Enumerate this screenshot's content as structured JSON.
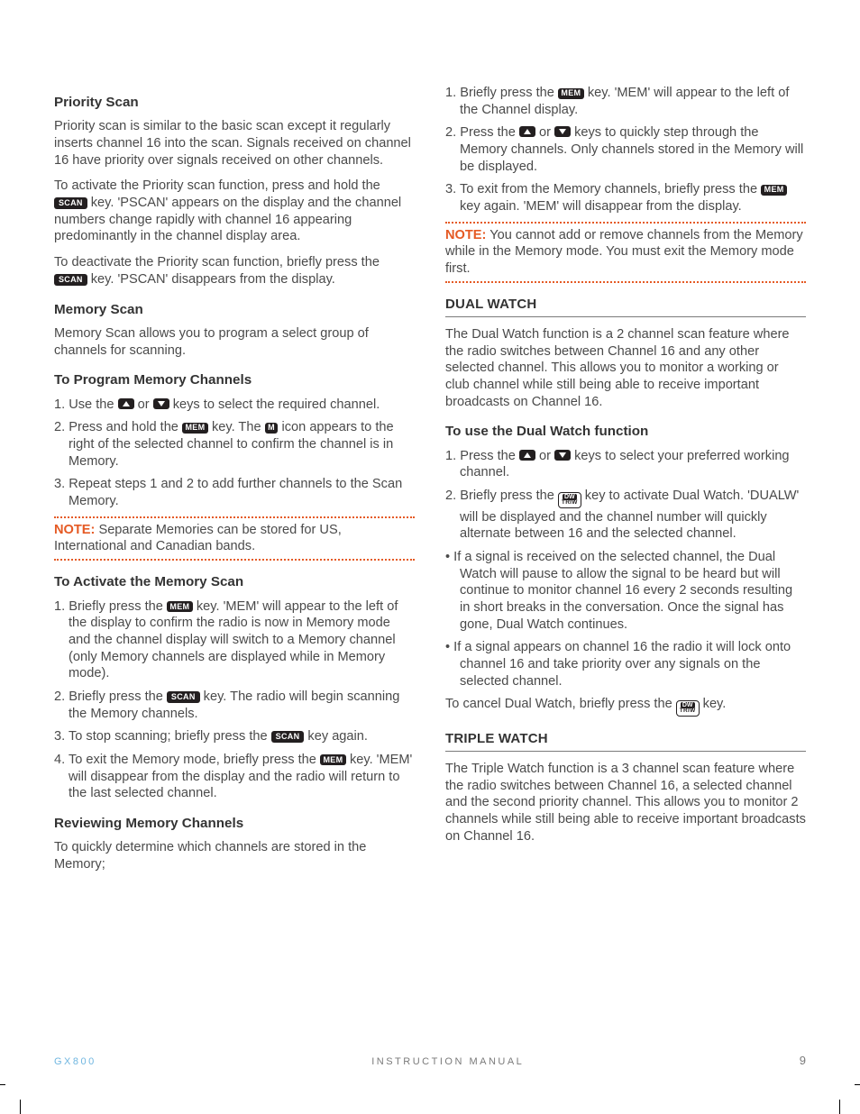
{
  "left": {
    "h1": "Priority Scan",
    "p1": "Priority scan is similar to the basic scan except it regularly inserts channel 16 into the scan. Signals received on channel 16 have priority over signals received on other channels.",
    "p2a": "To activate the Priority scan function, press and hold the ",
    "p2b": " key. 'PSCAN' appears on the display and the channel numbers change rapidly with channel 16 appearing predominantly in the channel display area.",
    "p3a": "To deactivate the Priority scan function, briefly press the ",
    "p3b": " key. 'PSCAN' disappears from the display.",
    "h2": "Memory Scan",
    "p4": "Memory Scan allows you to program a select group of channels for scanning.",
    "h3": "To Program Memory Channels",
    "s1a": "1. Use the ",
    "s1b": " or ",
    "s1c": " keys to select the required channel.",
    "s2a": "2. Press and hold the ",
    "s2b": " key. The ",
    "s2c": " icon appears to the right of the selected channel to confirm the channel is in Memory.",
    "s3": "3. Repeat steps 1 and 2 to add further channels to the Scan Memory.",
    "noteLabel": "NOTE:",
    "noteText": " Separate Memories can be stored for US, International and Canadian bands.",
    "h4": "To Activate the Memory Scan",
    "a1a": "1. Briefly press the ",
    "a1b": " key. 'MEM' will appear to the left of the display to confirm the radio is now in Memory mode and the channel display will switch to a Memory channel (only Memory channels are displayed while in Memory mode).",
    "a2a": "2. Briefly press the ",
    "a2b": " key. The radio will begin scanning the Memory channels.",
    "a3a": "3. To stop scanning; briefly press the ",
    "a3b": " key again.",
    "a4a": "4. To exit the Memory mode, briefly press the ",
    "a4b": " key. 'MEM' will disappear from the display and the radio will return to the last selected channel.",
    "h5": "Reviewing Memory Channels",
    "p5": "To quickly determine which channels are stored in the Memory;"
  },
  "right": {
    "r1a": "1. Briefly press the ",
    "r1b": " key. 'MEM' will appear to the left of the Channel display.",
    "r2a": "2. Press the ",
    "r2b": " or ",
    "r2c": " keys to quickly step through the Memory channels. Only channels stored in the Memory will be displayed.",
    "r3a": "3. To exit from the Memory channels, briefly press the ",
    "r3b": " key again. 'MEM' will disappear from the display.",
    "noteLabel": "NOTE:",
    "noteText": " You cannot add or remove channels from the Memory while in the Memory mode. You must exit the Memory mode first.",
    "h1": "DUAL WATCH",
    "p1": "The Dual Watch function is a 2 channel scan feature where the radio switches between Channel 16 and any other selected channel. This allows you to monitor a working or club channel while still being able to receive important broadcasts on Channel 16.",
    "h2": "To use the Dual Watch function",
    "d1a": "1. Press the ",
    "d1b": " or ",
    "d1c": " keys to select your preferred working channel.",
    "d2a": "2. Briefly press the ",
    "d2b": " key to activate Dual Watch. 'DUALW' will be displayed and the channel number will quickly alternate between 16 and the selected channel.",
    "b1": "•  If a signal is received on the selected channel, the Dual Watch will pause to allow the signal to be heard but will continue to monitor channel 16 every 2 seconds resulting in short breaks in the conversation. Once the signal has gone, Dual Watch continues.",
    "b2": "•  If a signal appears on channel 16 the radio it will lock onto channel 16 and take priority over any signals on the selected channel.",
    "p2a": "To cancel Dual Watch, briefly press the ",
    "p2b": " key.",
    "h3": "TRIPLE WATCH",
    "p3": "The Triple Watch function is a 3 channel scan feature where the radio switches between Channel 16, a selected channel and the second priority channel. This allows you to monitor 2 channels while still being able to receive important broadcasts on Channel 16."
  },
  "keys": {
    "scan": "SCAN",
    "mem": "MEM",
    "m": "M",
    "dw": "DW",
    "triw": "TRIW"
  },
  "footer": {
    "model": "GX800",
    "title": "INSTRUCTION MANUAL",
    "page": "9"
  }
}
